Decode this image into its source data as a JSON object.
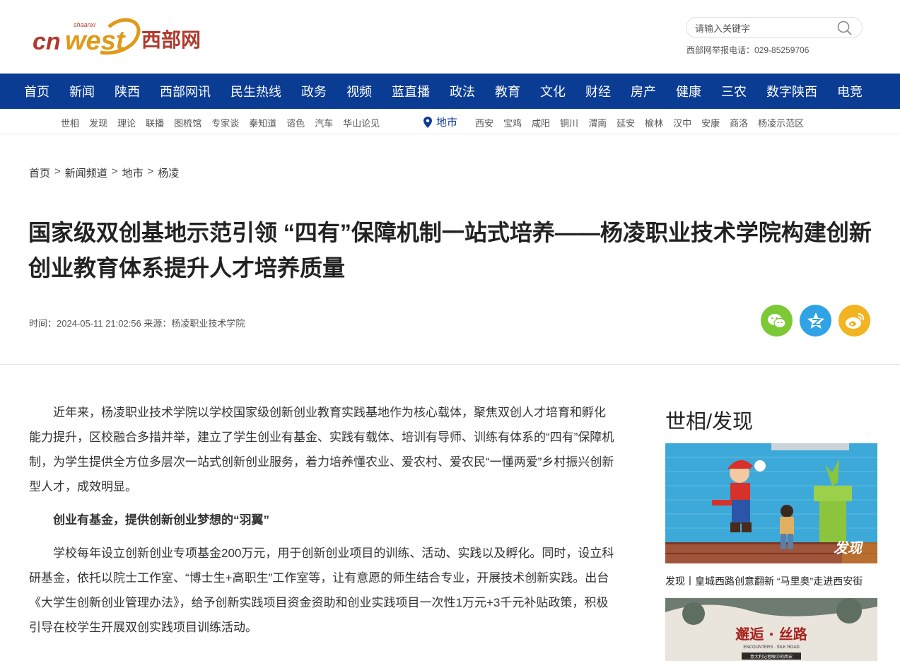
{
  "header": {
    "logo_text": "西部网",
    "logo_brand": "cnwest",
    "logo_sub": "shaanxi",
    "search_placeholder": "请输入关键字",
    "report_phone": "西部网举报电话：029-85259706"
  },
  "main_nav": [
    "首页",
    "新闻",
    "陕西",
    "西部网讯",
    "民生热线",
    "政务",
    "视频",
    "蓝直播",
    "政法",
    "教育",
    "文化",
    "财经",
    "房产",
    "健康",
    "三农",
    "数字陕西",
    "电竞"
  ],
  "sub_nav": {
    "left": [
      "世相",
      "发现",
      "理论",
      "联播",
      "图梳馆",
      "专家谈",
      "秦知道",
      "谘色",
      "汽车",
      "华山论见"
    ],
    "city_label": "地市",
    "cities": [
      "西安",
      "宝鸡",
      "咸阳",
      "铜川",
      "渭南",
      "延安",
      "榆林",
      "汉中",
      "安康",
      "商洛",
      "杨凌示范区"
    ]
  },
  "breadcrumb": [
    "首页",
    "新闻频道",
    "地市",
    "杨凌"
  ],
  "breadcrumb_sep": ">",
  "article": {
    "title": "国家级双创基地示范引领 “四有”保障机制一站式培养——杨凌职业技术学院构建创新创业教育体系提升人才培养质量",
    "meta": "时间：2024-05-11 21:02:56  来源：杨凌职业技术学院",
    "paragraphs": [
      "近年来，杨凌职业技术学院以学校国家级创新创业教育实践基地作为核心载体，聚焦双创人才培育和孵化能力提升，区校融合多措并举，建立了学生创业有基金、实践有载体、培训有导师、训练有体系的“四有”保障机制，为学生提供全方位多层次一站式创新创业服务，着力培养懂农业、爱农村、爱农民“一懂两爱”乡村振兴创新型人才，成效明显。",
      "创业有基金，提供创新创业梦想的“羽翼”",
      "学校每年设立创新创业专项基金200万元，用于创新创业项目的训练、活动、实践以及孵化。同时，设立科研基金，依托以院士工作室、“博士生+高职生”工作室等，让有意愿的师生结合专业，开展技术创新实践。出台《大学生创新创业管理办法》，给予创新实践项目资金资助和创业实践项目一次性1万元+3千元补贴政策，积极引导在校学生开展双创实践项目训练活动。"
    ]
  },
  "share": {
    "wechat_icon": "wechat-icon",
    "qzone_icon": "qzone-icon",
    "weibo_icon": "weibo-icon"
  },
  "sidebar": {
    "title": "世相/发现",
    "card1": {
      "image_label": "发现",
      "caption": "发现丨皇城西路创意翻新 “马里奥”走进西安街"
    },
    "card2": {
      "image_title": "邂逅 · 丝路",
      "image_sub": "ENCOUNTERS · SILK ROAD",
      "image_note": "意大利记者眼中的西安"
    }
  },
  "colors": {
    "nav_blue": "#0b3c93",
    "logo_red": "#c0392b",
    "logo_orange": "#e8a020",
    "wechat": "#7cc936",
    "qzone": "#2fa3e6",
    "weibo": "#f3b421"
  }
}
